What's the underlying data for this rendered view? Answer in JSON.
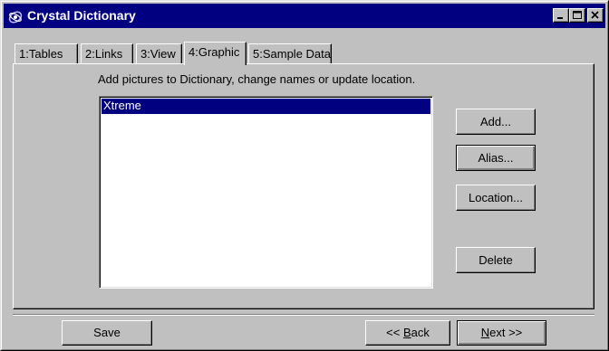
{
  "window": {
    "title": "Crystal Dictionary",
    "controls": [
      "minimize-icon",
      "maximize-icon",
      "close-icon"
    ],
    "title_bar_color": "#000080"
  },
  "tabs": [
    {
      "label": "1:Tables",
      "active": false
    },
    {
      "label": "2:Links",
      "active": false
    },
    {
      "label": "3:View",
      "active": false
    },
    {
      "label": "4:Graphic",
      "active": true
    },
    {
      "label": "5:Sample Data",
      "active": false
    }
  ],
  "graphic_panel": {
    "instruction": "Add pictures to Dictionary, change names or update location.",
    "pictures": [
      {
        "name": "Xtreme",
        "selected": true
      }
    ],
    "buttons": {
      "add": "Add...",
      "alias": "Alias...",
      "location": "Location...",
      "delete": "Delete"
    }
  },
  "footer": {
    "save": "Save",
    "back_prefix": "<< ",
    "back_mnemonic": "B",
    "back_rest": "ack",
    "next_mnemonic": "N",
    "next_rest": "ext >>"
  }
}
